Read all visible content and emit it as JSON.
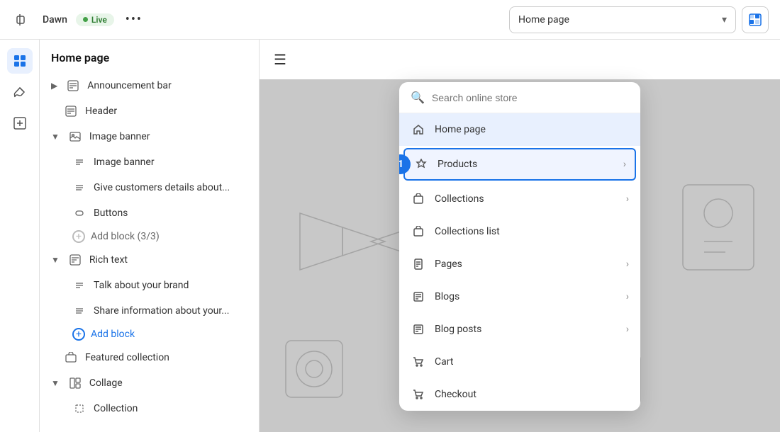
{
  "topbar": {
    "app_name": "Dawn",
    "live_label": "Live",
    "more_label": "•••",
    "page_selector": {
      "current": "Home page",
      "placeholder": "Home page"
    },
    "grid_icon": "grid-icon"
  },
  "icon_sidebar": {
    "icons": [
      {
        "name": "layout-icon",
        "symbol": "⊞",
        "active": true
      },
      {
        "name": "brush-icon",
        "symbol": "✏",
        "active": false
      },
      {
        "name": "plus-square-icon",
        "symbol": "⊕",
        "active": false
      }
    ]
  },
  "sidebar": {
    "title": "Home page",
    "items": [
      {
        "id": "announcement-bar",
        "label": "Announcement bar",
        "icon": "announcement-icon",
        "level": 0,
        "expandable": true
      },
      {
        "id": "header",
        "label": "Header",
        "icon": "header-icon",
        "level": 0,
        "expandable": false
      },
      {
        "id": "image-banner",
        "label": "Image banner",
        "icon": "image-icon",
        "level": 0,
        "expandable": true,
        "expanded": true
      },
      {
        "id": "image-banner-sub",
        "label": "Image banner",
        "icon": "text-icon",
        "level": 1
      },
      {
        "id": "give-customers",
        "label": "Give customers details about...",
        "icon": "list-icon",
        "level": 1
      },
      {
        "id": "buttons",
        "label": "Buttons",
        "icon": "buttons-icon",
        "level": 1
      },
      {
        "id": "add-block",
        "label": "Add block (3/3)",
        "level": 1,
        "isAdd": true
      },
      {
        "id": "rich-text",
        "label": "Rich text",
        "icon": "text-icon2",
        "level": 0,
        "expandable": true,
        "expanded": true
      },
      {
        "id": "talk-brand",
        "label": "Talk about your brand",
        "icon": "text-icon3",
        "level": 1
      },
      {
        "id": "share-info",
        "label": "Share information about your...",
        "icon": "list-icon2",
        "level": 1
      },
      {
        "id": "add-block-2",
        "label": "Add block",
        "level": 1,
        "isAddLink": true
      },
      {
        "id": "featured-collection",
        "label": "Featured collection",
        "icon": "featured-icon",
        "level": 0
      },
      {
        "id": "collage",
        "label": "Collage",
        "icon": "collage-icon",
        "level": 0,
        "expandable": true,
        "expanded": true
      },
      {
        "id": "collection",
        "label": "Collection",
        "icon": "collection-icon",
        "level": 1
      }
    ]
  },
  "search": {
    "placeholder": "Search online store",
    "value": ""
  },
  "dropdown": {
    "items": [
      {
        "id": "home-page",
        "label": "Home page",
        "icon": "home-icon",
        "hasArrow": false,
        "selected": true
      },
      {
        "id": "products",
        "label": "Products",
        "icon": "tag-icon",
        "hasArrow": true,
        "highlighted": true
      },
      {
        "id": "collections",
        "label": "Collections",
        "icon": "tag-icon2",
        "hasArrow": true
      },
      {
        "id": "collections-list",
        "label": "Collections list",
        "icon": "tag-icon3",
        "hasArrow": false
      },
      {
        "id": "pages",
        "label": "Pages",
        "icon": "page-icon",
        "hasArrow": true
      },
      {
        "id": "blogs",
        "label": "Blogs",
        "icon": "blog-icon",
        "hasArrow": true
      },
      {
        "id": "blog-posts",
        "label": "Blog posts",
        "icon": "blog-icon2",
        "hasArrow": true
      },
      {
        "id": "cart",
        "label": "Cart",
        "icon": "cart-icon",
        "hasArrow": false
      },
      {
        "id": "checkout",
        "label": "Checkout",
        "icon": "checkout-icon",
        "hasArrow": false
      }
    ],
    "step_number": "1"
  },
  "preview": {
    "hamburger": "☰"
  }
}
